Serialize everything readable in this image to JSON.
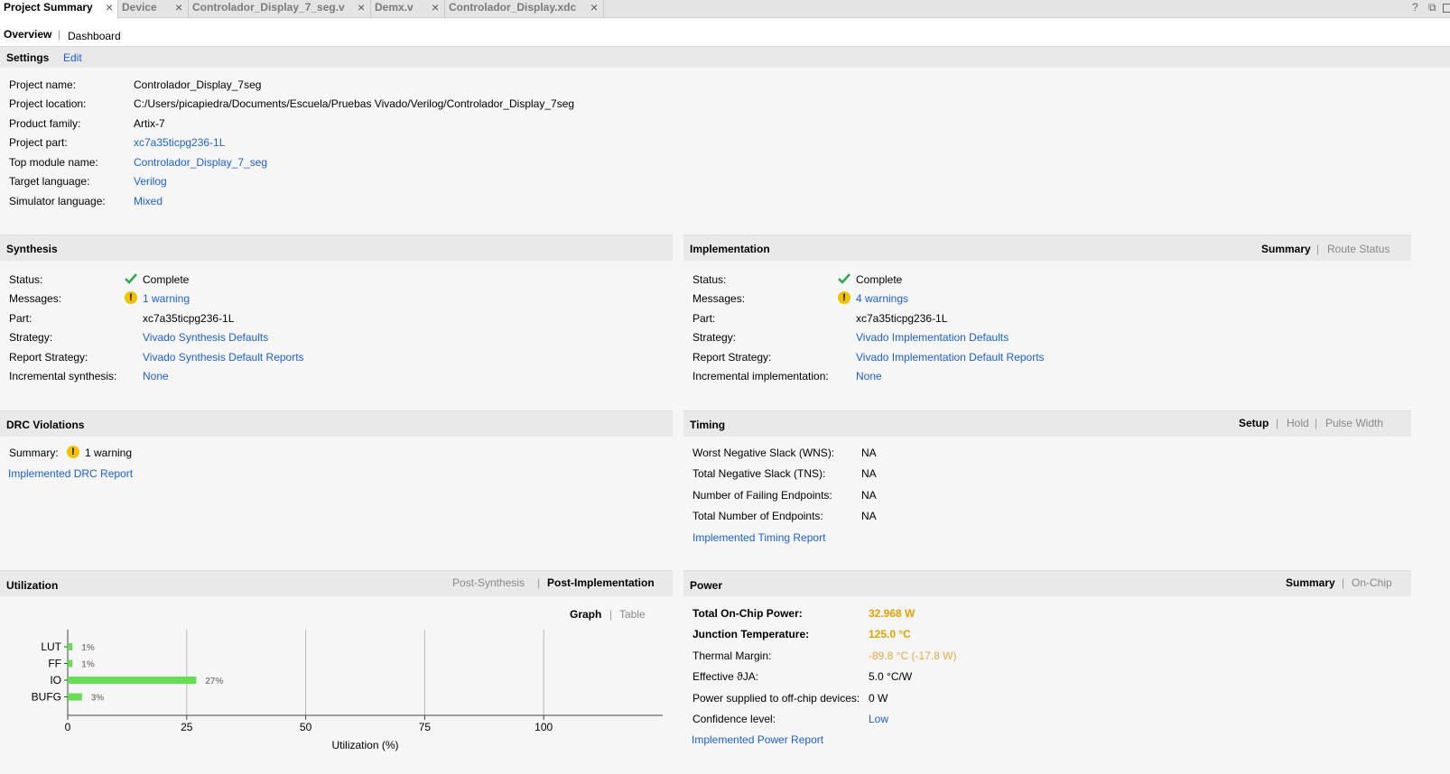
{
  "tabs": [
    {
      "label": "Project Summary",
      "active": true
    },
    {
      "label": "Device",
      "active": false
    },
    {
      "label": "Controlador_Display_7_seg.v",
      "active": false
    },
    {
      "label": "Demx.v",
      "active": false
    },
    {
      "label": "Controlador_Display.xdc",
      "active": false
    }
  ],
  "window_controls": {
    "help": "?",
    "restore": "⧉"
  },
  "subnav": {
    "overview": "Overview",
    "sep": "|",
    "dashboard": "Dashboard"
  },
  "settings": {
    "title": "Settings",
    "edit": "Edit",
    "rows": [
      {
        "label": "Project name:",
        "value": "Controlador_Display_7seg",
        "link": false
      },
      {
        "label": "Project location:",
        "value": "C:/Users/picapiedra/Documents/Escuela/Pruebas Vivado/Verilog/Controlador_Display_7seg",
        "link": false
      },
      {
        "label": "Product family:",
        "value": "Artix-7",
        "link": false
      },
      {
        "label": "Project part:",
        "value": "xc7a35ticpg236-1L",
        "link": true
      },
      {
        "label": "Top module name:",
        "value": "Controlador_Display_7_seg",
        "link": true
      },
      {
        "label": "Target language:",
        "value": "Verilog",
        "link": true
      },
      {
        "label": "Simulator language:",
        "value": "Mixed",
        "link": true
      }
    ]
  },
  "synthesis": {
    "title": "Synthesis",
    "status_label": "Status:",
    "status": "Complete",
    "messages_label": "Messages:",
    "messages": "1 warning",
    "part_label": "Part:",
    "part": "xc7a35ticpg236-1L",
    "strategy_label": "Strategy:",
    "strategy": "Vivado Synthesis Defaults",
    "report_label": "Report Strategy:",
    "report": "Vivado Synthesis Default Reports",
    "incr_label": "Incremental synthesis:",
    "incr": "None"
  },
  "implementation": {
    "title": "Implementation",
    "opt_summary": "Summary",
    "opt_route": "Route Status",
    "status_label": "Status:",
    "status": "Complete",
    "messages_label": "Messages:",
    "messages": "4 warnings",
    "part_label": "Part:",
    "part": "xc7a35ticpg236-1L",
    "strategy_label": "Strategy:",
    "strategy": "Vivado Implementation Defaults",
    "report_label": "Report Strategy:",
    "report": "Vivado Implementation Default Reports",
    "incr_label": "Incremental implementation:",
    "incr": "None"
  },
  "drc": {
    "title": "DRC Violations",
    "summary_label": "Summary:",
    "summary": "1 warning",
    "report": "Implemented DRC Report"
  },
  "timing": {
    "title": "Timing",
    "opt_setup": "Setup",
    "opt_hold": "Hold",
    "opt_pulse": "Pulse Width",
    "rows": [
      {
        "label": "Worst Negative Slack (WNS):",
        "value": "NA"
      },
      {
        "label": "Total Negative Slack (TNS):",
        "value": "NA"
      },
      {
        "label": "Number of Failing Endpoints:",
        "value": "NA"
      },
      {
        "label": "Total Number of Endpoints:",
        "value": "NA"
      }
    ],
    "report": "Implemented Timing Report"
  },
  "utilization": {
    "title": "Utilization",
    "opt_post_synth": "Post-Synthesis",
    "opt_post_impl": "Post-Implementation",
    "opt_graph": "Graph",
    "opt_table": "Table"
  },
  "power": {
    "title": "Power",
    "opt_summary": "Summary",
    "opt_onchip": "On-Chip",
    "total_label": "Total On-Chip Power:",
    "total": "32.968 W",
    "junction_label": "Junction Temperature:",
    "junction": "125.0 °C",
    "margin_label": "Thermal Margin:",
    "margin": "-89.8 °C (-17.8 W)",
    "theta_label": "Effective ϑJA:",
    "theta": "5.0 °C/W",
    "offchip_label": "Power supplied to off-chip devices:",
    "offchip": "0 W",
    "confidence_label": "Confidence level:",
    "confidence": "Low",
    "report": "Implemented Power Report"
  },
  "chart_data": {
    "type": "bar",
    "orientation": "horizontal",
    "categories": [
      "LUT",
      "FF",
      "IO",
      "BUFG"
    ],
    "values": [
      1,
      1,
      27,
      3
    ],
    "labels": [
      "1%",
      "1%",
      "27%",
      "3%"
    ],
    "xlabel": "Utilization (%)",
    "ylabel": "",
    "xlim": [
      0,
      125
    ],
    "xticks": [
      0,
      25,
      50,
      75,
      100
    ],
    "grid": true,
    "bar_color": "#66dd55"
  }
}
